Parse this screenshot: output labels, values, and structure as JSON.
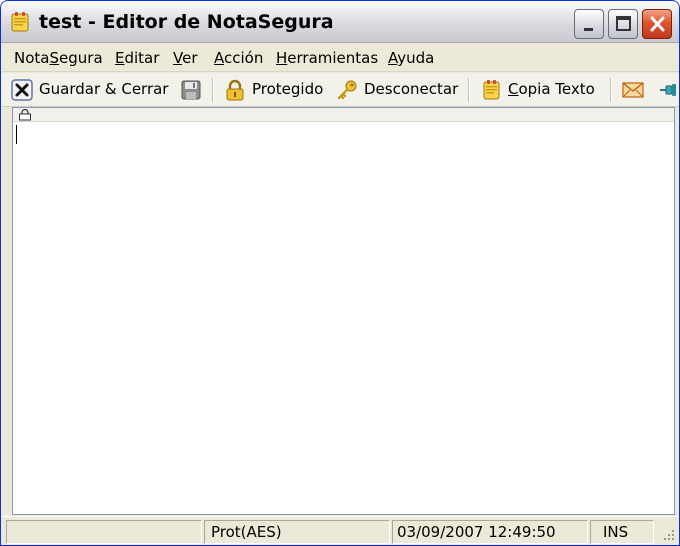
{
  "window": {
    "title": "test - Editor de NotaSegura"
  },
  "menu": [
    {
      "id": "notasegura",
      "pre": "Nota",
      "mnemonic": "S",
      "post": "egura"
    },
    {
      "id": "editar",
      "pre": "",
      "mnemonic": "E",
      "post": "ditar"
    },
    {
      "id": "ver",
      "pre": "",
      "mnemonic": "V",
      "post": "er"
    },
    {
      "id": "accion",
      "pre": "",
      "mnemonic": "A",
      "post": "cción"
    },
    {
      "id": "herramientas",
      "pre": "",
      "mnemonic": "H",
      "post": "erramientas"
    },
    {
      "id": "ayuda",
      "pre": "",
      "mnemonic": "A",
      "post": "yuda"
    }
  ],
  "toolbar": {
    "save_close": {
      "label": "Guardar & Cerrar",
      "icon": "close-x-icon"
    },
    "save": {
      "icon": "floppy-disk-icon"
    },
    "protected": {
      "label": "Protegido",
      "icon": "padlock-icon"
    },
    "disconnect": {
      "label": "Desconectar",
      "icon": "key-icon"
    },
    "copy_text": {
      "pre": "",
      "mnemonic": "C",
      "post": "opia Texto",
      "icon": "note-copy-icon"
    },
    "email": {
      "icon": "envelope-icon"
    },
    "pin": {
      "icon": "pushpin-icon"
    }
  },
  "editor": {
    "content": ""
  },
  "statusbar": {
    "panel1": "",
    "protection": "Prot(AES)",
    "datetime": "03/09/2007 12:49:50",
    "mode": "INS"
  },
  "colors": {
    "frame_blue": "#0831d9",
    "close_red": "#e0542e",
    "face": "#ece9d8"
  }
}
